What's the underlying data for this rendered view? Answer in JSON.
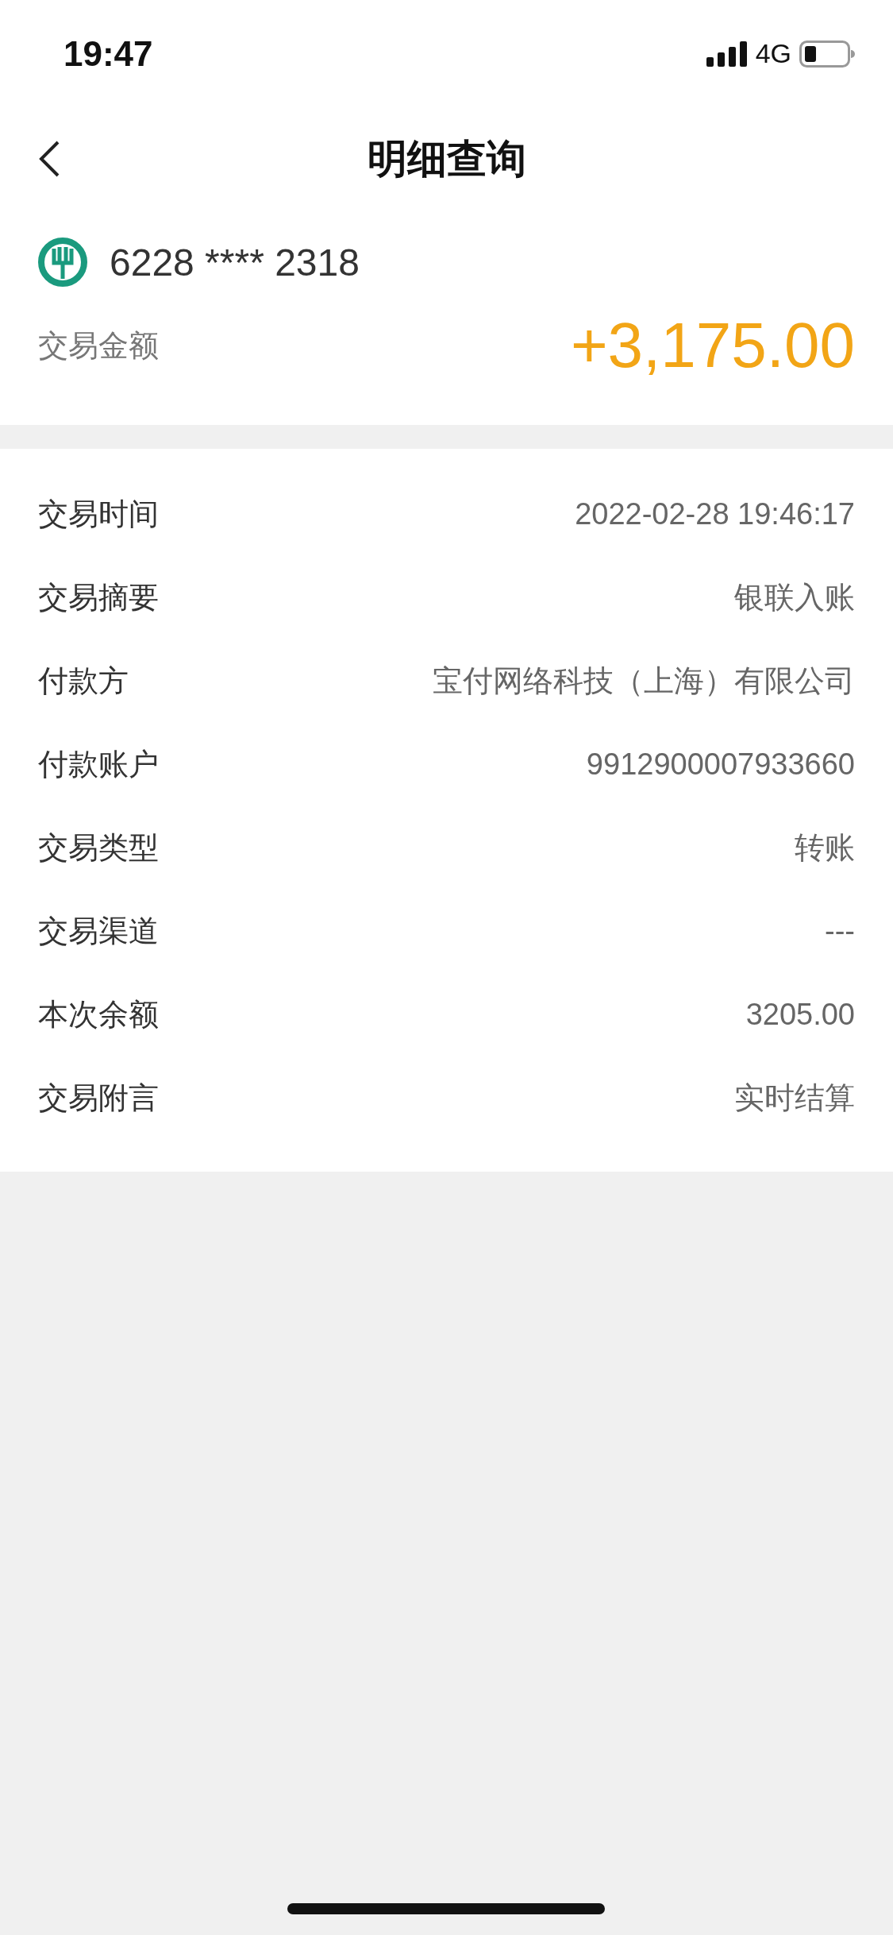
{
  "status_bar": {
    "time": "19:47",
    "network": "4G"
  },
  "nav": {
    "title": "明细查询"
  },
  "summary": {
    "card_number": "6228 **** 2318",
    "amount_label": "交易金额",
    "amount": "+3,175.00"
  },
  "details": [
    {
      "label": "交易时间",
      "value": "2022-02-28 19:46:17"
    },
    {
      "label": "交易摘要",
      "value": "银联入账"
    },
    {
      "label": "付款方",
      "value": "宝付网络科技（上海）有限公司"
    },
    {
      "label": "付款账户",
      "value": "9912900007933660"
    },
    {
      "label": "交易类型",
      "value": "转账"
    },
    {
      "label": "交易渠道",
      "value": "---"
    },
    {
      "label": "本次余额",
      "value": "3205.00"
    },
    {
      "label": "交易附言",
      "value": "实时结算"
    }
  ]
}
